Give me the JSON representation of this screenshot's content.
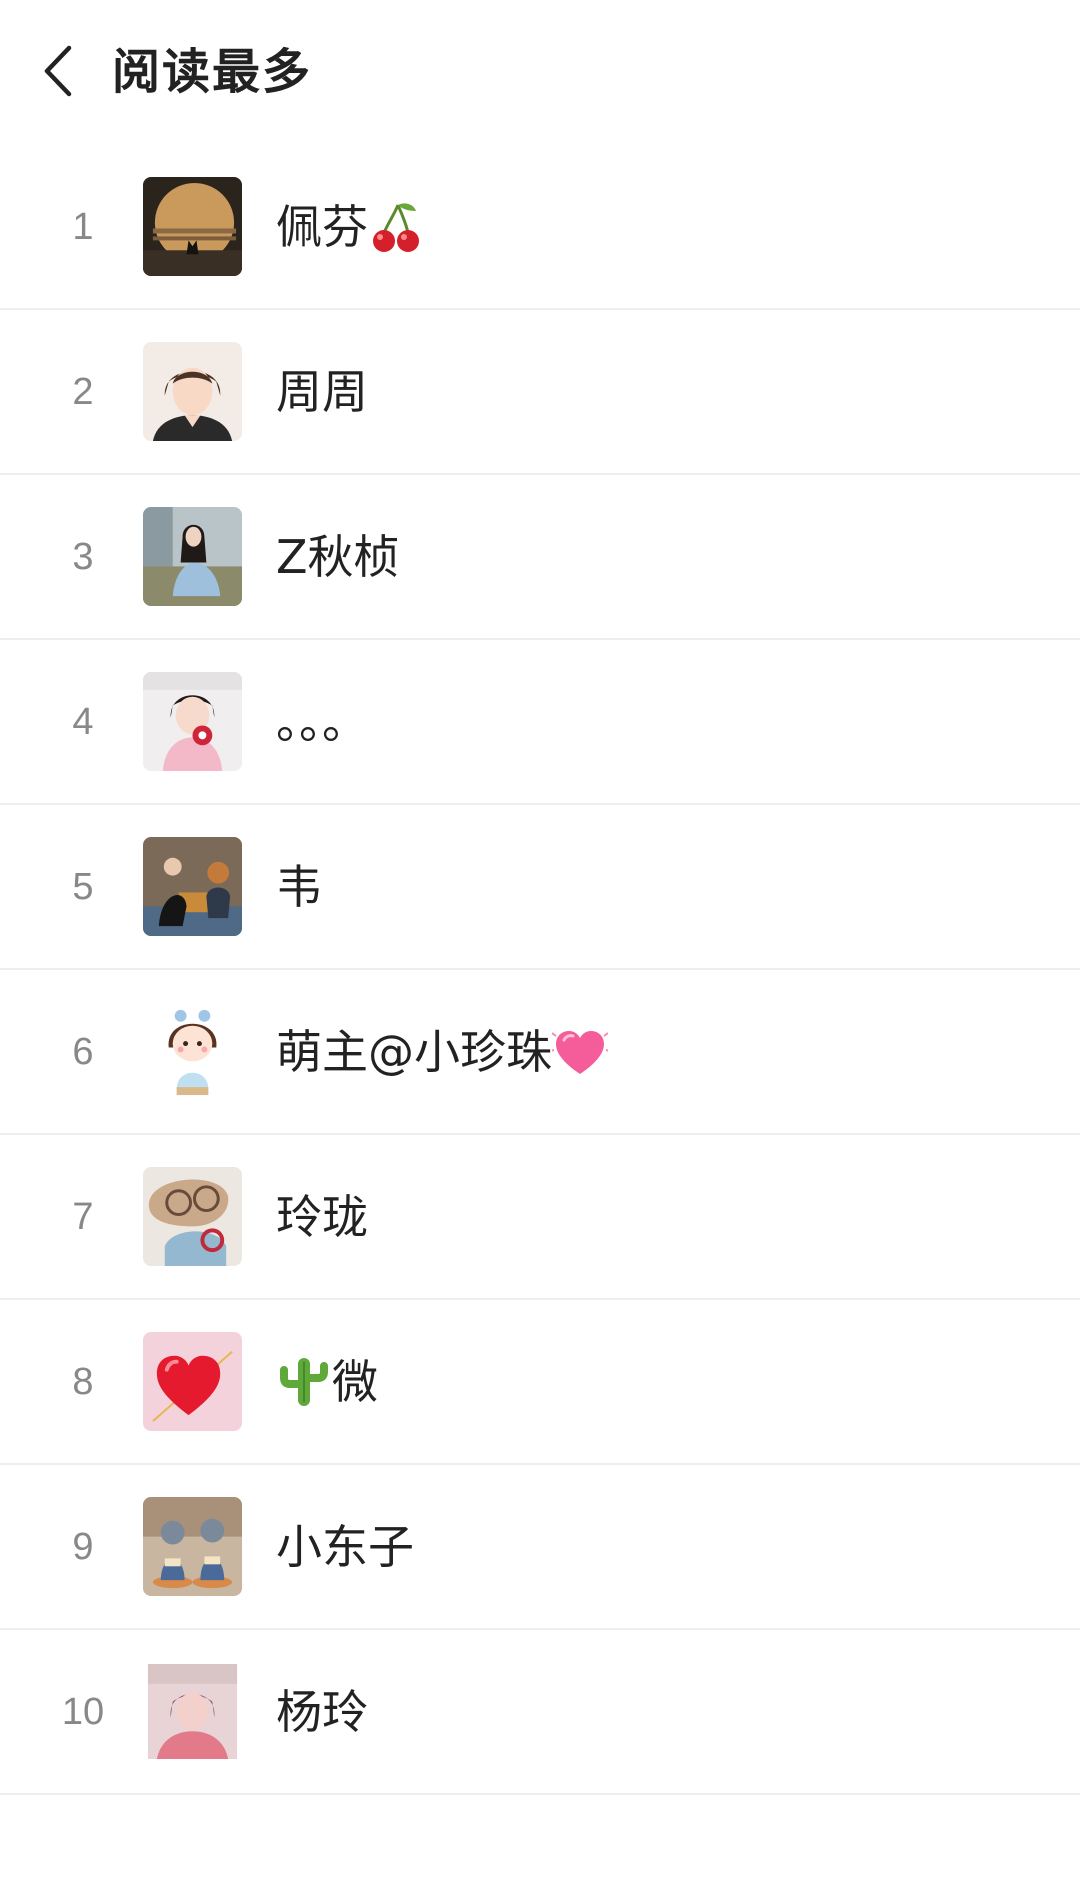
{
  "header": {
    "back_icon": "chevron-left-icon",
    "title": "阅读最多"
  },
  "ranking": [
    {
      "rank": "1",
      "name": "佩芬",
      "emoji": "cherry-icon",
      "avatar": "sunset-silhouette-avatar"
    },
    {
      "rank": "2",
      "name": "周周",
      "emoji": "",
      "avatar": "woman-portrait-avatar"
    },
    {
      "rank": "3",
      "name": "Z秋桢",
      "emoji": "",
      "avatar": "woman-outdoor-avatar"
    },
    {
      "rank": "4",
      "name": "。。。",
      "emoji": "",
      "avatar": "child-photo-avatar"
    },
    {
      "rank": "5",
      "name": "韦",
      "emoji": "",
      "avatar": "group-photo-avatar"
    },
    {
      "rank": "6",
      "name": "萌主@小珍珠",
      "emoji": "pink-heart-icon",
      "avatar": "cartoon-girl-avatar"
    },
    {
      "rank": "7",
      "name": "玲珑",
      "emoji": "",
      "avatar": "cartoon-glasses-avatar"
    },
    {
      "rank": "8",
      "name": "微",
      "emoji_prefix": "cactus-icon",
      "avatar": "red-heart-avatar"
    },
    {
      "rank": "9",
      "name": "小东子",
      "emoji": "",
      "avatar": "figurines-avatar"
    },
    {
      "rank": "10",
      "name": "杨玲",
      "emoji": "",
      "avatar": "pink-portrait-avatar"
    }
  ],
  "colors": {
    "rank_text": "#888888",
    "name_text": "#222222",
    "divider": "#eeeeee",
    "background": "#ffffff"
  }
}
